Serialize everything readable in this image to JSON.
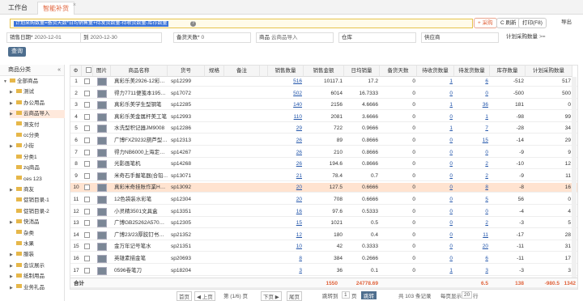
{
  "tabs": [
    {
      "label": "工作台"
    },
    {
      "label": "智能补货"
    }
  ],
  "formula": "计划采购数量=备货天数*日均销售量+待发货数量-待收货数量-库存数量",
  "toolbar": {
    "buy": "+ 采购",
    "refresh": "C 刷新",
    "print": "打印(F8)",
    "export": "导出"
  },
  "filters": {
    "sales_date_label": "销售日期*",
    "sales_date_from": "2020-12-01",
    "sales_date_sep": "到",
    "sales_date_to": "2020-12-30",
    "stock_days_label": "备货天数*",
    "stock_days_value": "0",
    "product_label": "商品",
    "product_value": "云商品导入",
    "warehouse_label": "仓库",
    "warehouse_value": "",
    "supplier_label": "供应商",
    "supplier_value": "",
    "plan_qty_label": "计划采购数量",
    "plan_qty_op": ">=",
    "plan_qty_value": ""
  },
  "search_label": "查询",
  "tree": {
    "header": "商品分类",
    "nodes": [
      {
        "label": "全部商品",
        "level": 0,
        "arrow": "▼"
      },
      {
        "label": "测试",
        "level": 1,
        "arrow": "▶"
      },
      {
        "label": "办公用品",
        "level": 1,
        "arrow": "▶"
      },
      {
        "label": "云商品导入",
        "level": 1,
        "arrow": "▶",
        "selected": true
      },
      {
        "label": "测支付",
        "level": 1,
        "arrow": ""
      },
      {
        "label": "cc分类",
        "level": 1,
        "arrow": ""
      },
      {
        "label": "小街",
        "level": 1,
        "arrow": "▶"
      },
      {
        "label": "分类1",
        "level": 1,
        "arrow": ""
      },
      {
        "label": "zq商品",
        "level": 1,
        "arrow": ""
      },
      {
        "label": "ces 123",
        "level": 1,
        "arrow": ""
      },
      {
        "label": "商友",
        "level": 1,
        "arrow": "▶"
      },
      {
        "label": "促销目录-1",
        "level": 1,
        "arrow": ""
      },
      {
        "label": "促销目录-2",
        "level": 1,
        "arrow": ""
      },
      {
        "label": "快消品",
        "level": 1,
        "arrow": "▶"
      },
      {
        "label": "杂类",
        "level": 1,
        "arrow": ""
      },
      {
        "label": "水果",
        "level": 1,
        "arrow": ""
      },
      {
        "label": "服装",
        "level": 1,
        "arrow": "▶"
      },
      {
        "label": "会议展示",
        "level": 1,
        "arrow": "▶"
      },
      {
        "label": "纸制用品",
        "level": 1,
        "arrow": "▶"
      },
      {
        "label": "业务礼品",
        "level": 1,
        "arrow": "▶"
      }
    ]
  },
  "columns": {
    "img": "图片",
    "name": "商品名称",
    "sku": "货号",
    "spec": "规格",
    "remark": "备注",
    "sales_qty": "销售数量",
    "sales_amt": "销售金额",
    "daily": "日均销量",
    "stock_days": "备货天数",
    "to_receive": "待收货数量",
    "to_ship": "待发货数量",
    "stock": "库存数量",
    "plan": "计划采购数量"
  },
  "rows": [
    {
      "no": "1",
      "name": "真彩乐美2926-12彩…",
      "sku": "sp12299",
      "sales_qty": "516",
      "sales_amt": "10117.1",
      "daily": "17.2",
      "stock_days": "0",
      "to_receive": "1",
      "to_ship": "6",
      "stock": "-512",
      "plan": "517"
    },
    {
      "no": "2",
      "name": "得力7711便笺本195…",
      "sku": "sp17072",
      "sales_qty": "502",
      "sales_amt": "6014",
      "daily": "16.7333",
      "stock_days": "0",
      "to_receive": "0",
      "to_ship": "0",
      "stock": "-500",
      "plan": "500"
    },
    {
      "no": "3",
      "name": "真彩乐美学生型钢笔",
      "sku": "sp12285",
      "sales_qty": "140",
      "sales_amt": "2156",
      "daily": "4.6666",
      "stock_days": "0",
      "to_receive": "1",
      "to_ship": "36",
      "stock": "181",
      "plan": "0"
    },
    {
      "no": "4",
      "name": "真彩乐美金属杆美工笔",
      "sku": "sp12993",
      "sales_qty": "110",
      "sales_amt": "2081",
      "daily": "3.6666",
      "stock_days": "0",
      "to_receive": "0",
      "to_ship": "1",
      "stock": "-98",
      "plan": "99"
    },
    {
      "no": "5",
      "name": "水洗型积记器JM9008",
      "sku": "sp12286",
      "sales_qty": "29",
      "sales_amt": "722",
      "daily": "0.9666",
      "stock_days": "0",
      "to_receive": "1",
      "to_ship": "7",
      "stock": "-28",
      "plan": "34"
    },
    {
      "no": "6",
      "name": "广博FXZ9232葫芦型…",
      "sku": "sp12313",
      "sales_qty": "26",
      "sales_amt": "89",
      "daily": "0.8666",
      "stock_days": "0",
      "to_receive": "0",
      "to_ship": "15",
      "stock": "-14",
      "plan": "29"
    },
    {
      "no": "7",
      "name": "得力NB6000上海定…",
      "sku": "sp14267",
      "sales_qty": "26",
      "sales_amt": "210",
      "daily": "0.8666",
      "stock_days": "0",
      "to_receive": "0",
      "to_ship": "0",
      "stock": "-9",
      "plan": "9"
    },
    {
      "no": "8",
      "name": "光影画笔机",
      "sku": "sp14268",
      "sales_qty": "26",
      "sales_amt": "194.6",
      "daily": "0.8666",
      "stock_days": "0",
      "to_receive": "0",
      "to_ship": "2",
      "stock": "-10",
      "plan": "12"
    },
    {
      "no": "9",
      "name": "米奇石手握笔器(合铅…",
      "sku": "sp13071",
      "sales_qty": "21",
      "sales_amt": "78.4",
      "daily": "0.7",
      "stock_days": "0",
      "to_receive": "0",
      "to_ship": "2",
      "stock": "-9",
      "plan": "11"
    },
    {
      "no": "10",
      "name": "真彩米奇挂账作業H…",
      "sku": "sp13092",
      "sales_qty": "20",
      "sales_amt": "127.5",
      "daily": "0.6666",
      "stock_days": "0",
      "to_receive": "0",
      "to_ship": "8",
      "stock": "-8",
      "plan": "16",
      "selected": true
    },
    {
      "no": "11",
      "name": "12色袋装水彩笔",
      "sku": "sp12304",
      "sales_qty": "20",
      "sales_amt": "708",
      "daily": "0.6666",
      "stock_days": "0",
      "to_receive": "0",
      "to_ship": "5",
      "stock": "56",
      "plan": "0"
    },
    {
      "no": "12",
      "name": "小灵精3501文具盒",
      "sku": "sp13351",
      "sales_qty": "16",
      "sales_amt": "97.6",
      "daily": "0.5333",
      "stock_days": "0",
      "to_receive": "0",
      "to_ship": "0",
      "stock": "-4",
      "plan": "4"
    },
    {
      "no": "13",
      "name": "广博GB25262A570…",
      "sku": "sp12305",
      "sales_qty": "15",
      "sales_amt": "1021",
      "daily": "0.5",
      "stock_days": "0",
      "to_receive": "0",
      "to_ship": "2",
      "stock": "-3",
      "plan": "5"
    },
    {
      "no": "14",
      "name": "广博23/23厚胶钉书…",
      "sku": "sp21352",
      "sales_qty": "12",
      "sales_amt": "180",
      "daily": "0.4",
      "stock_days": "0",
      "to_receive": "0",
      "to_ship": "11",
      "stock": "-17",
      "plan": "28"
    },
    {
      "no": "15",
      "name": "金万年记号笔水",
      "sku": "sp21351",
      "sales_qty": "10",
      "sales_amt": "42",
      "daily": "0.3333",
      "stock_days": "0",
      "to_receive": "0",
      "to_ship": "20",
      "stock": "-11",
      "plan": "31"
    },
    {
      "no": "16",
      "name": "英雄素描金笔",
      "sku": "sp20693",
      "sales_qty": "8",
      "sales_amt": "384",
      "daily": "0.2666",
      "stock_days": "0",
      "to_receive": "0",
      "to_ship": "6",
      "stock": "-11",
      "plan": "17"
    },
    {
      "no": "17",
      "name": "0596卷笔刀",
      "sku": "sp18204",
      "sales_qty": "3",
      "sales_amt": "36",
      "daily": "0.1",
      "stock_days": "0",
      "to_receive": "1",
      "to_ship": "3",
      "stock": "-3",
      "plan": "3"
    }
  ],
  "totals": {
    "label": "合计",
    "sales_qty": "1550",
    "sales_amt": "24778.69",
    "to_receive": "6.5",
    "to_ship": "138",
    "stock": "-980.5",
    "plan": "1342"
  },
  "pager": {
    "first": "首页",
    "prev": "◀ 上页",
    "page_info": "第 (1/6) 页",
    "next": "下页 ▶",
    "last": "尾页",
    "goto_label": "跳转到",
    "goto_value": "1",
    "goto_unit": "页",
    "goto_btn": "跳转",
    "summary": "共 103 条记录",
    "per_page_label": "每页显示",
    "per_page": "20",
    "per_page_unit": "行"
  }
}
